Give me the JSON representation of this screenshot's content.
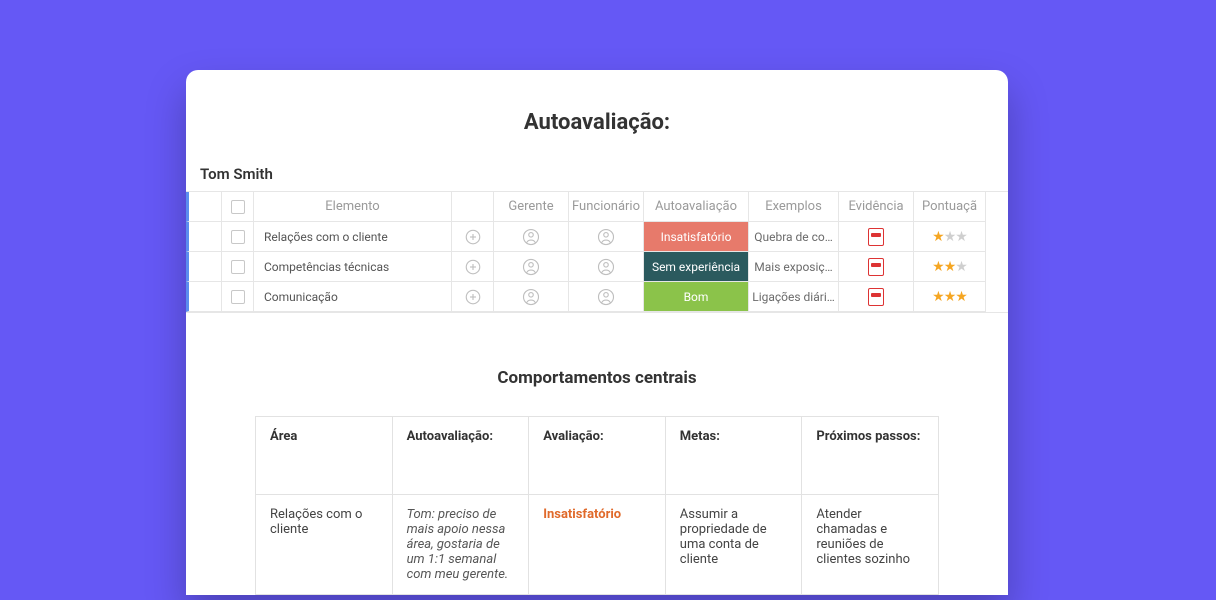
{
  "title": "Autoavaliação:",
  "employee": "Tom Smith",
  "grid_headers": {
    "elemento": "Elemento",
    "gerente": "Gerente",
    "funcionario": "Funcionário",
    "autoavaliacao": "Autoavaliação",
    "exemplos": "Exemplos",
    "evidencia": "Evidência",
    "pontuacao": "Pontuaçã"
  },
  "rows": [
    {
      "elem": "Relações com o cliente",
      "rating": "Insatisfatório",
      "rating_cls": "b-red",
      "example": "Quebra de co…",
      "stars": 1
    },
    {
      "elem": "Competências técnicas",
      "rating": "Sem experiência",
      "rating_cls": "b-teal",
      "example": "Mais exposiç…",
      "stars": 2
    },
    {
      "elem": "Comunicação",
      "rating": "Bom",
      "rating_cls": "b-green",
      "example": "Ligações diári…",
      "stars": 3
    }
  ],
  "core_title": "Comportamentos centrais",
  "core_headers": {
    "area": "Área",
    "auto": "Autoavaliação:",
    "aval": "Avaliação:",
    "metas": "Metas:",
    "proximos": "Próximos passos:"
  },
  "core_row": {
    "area": "Relações com o cliente",
    "auto": "Tom: preciso de mais apoio nessa área, gostaria de um 1:1 semanal com meu gerente.",
    "aval": "Insatisfatório",
    "metas": "Assumir a propriedade de uma conta de cliente",
    "proximos": "Atender chamadas e reuniões de clientes sozinho"
  }
}
